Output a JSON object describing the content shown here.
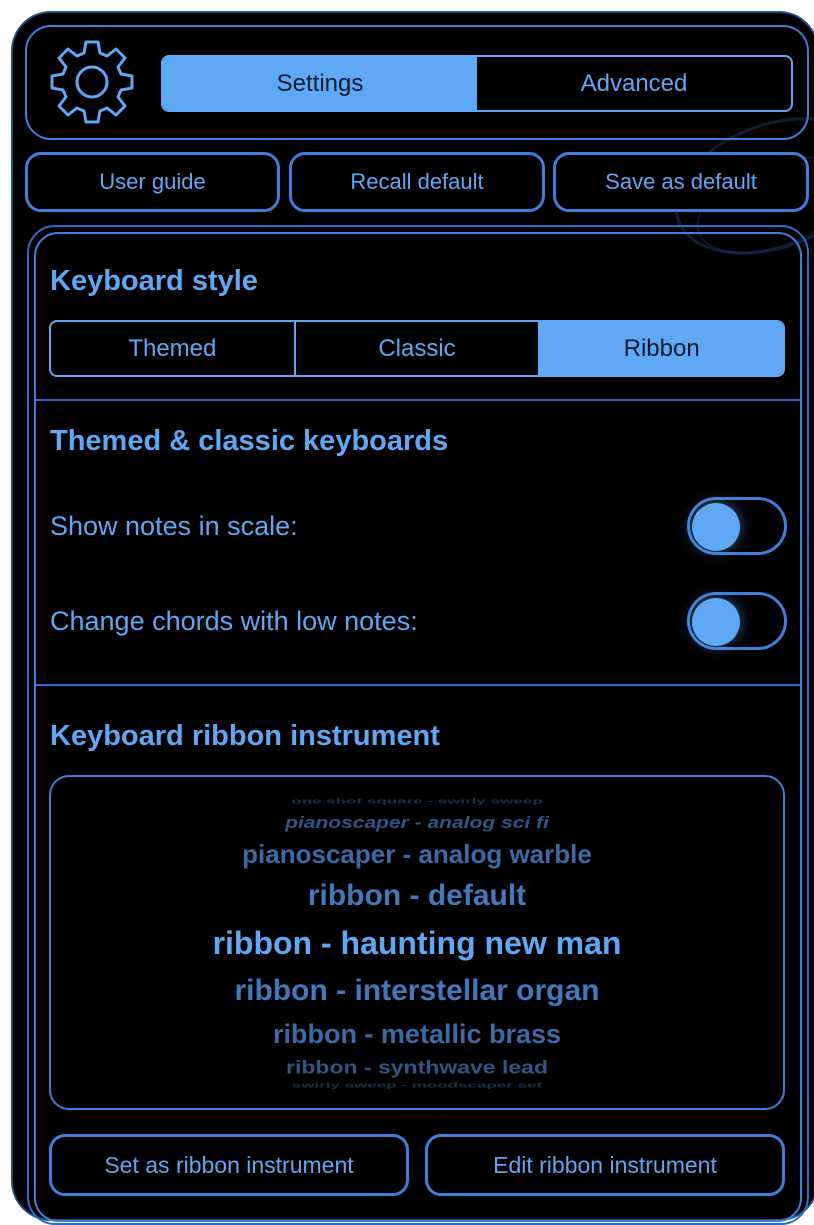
{
  "tabs": [
    {
      "label": "Settings",
      "active": true
    },
    {
      "label": "Advanced",
      "active": false
    }
  ],
  "actions": {
    "user_guide": "User guide",
    "recall_default": "Recall default",
    "save_default": "Save as default"
  },
  "keyboard_style": {
    "title": "Keyboard style",
    "options": [
      "Themed",
      "Classic",
      "Ribbon"
    ],
    "selected": "Ribbon"
  },
  "themed_classic": {
    "title": "Themed & classic keyboards",
    "show_notes_label": "Show notes in scale:",
    "show_notes_on": false,
    "change_chords_label": "Change chords with low notes:",
    "change_chords_on": false
  },
  "ribbon_instrument": {
    "title": "Keyboard ribbon instrument",
    "items": [
      "one shot square - swirly sweep",
      "pianoscaper - analog sci fi",
      "pianoscaper - analog warble",
      "ribbon - default",
      "ribbon - haunting new man",
      "ribbon - interstellar organ",
      "ribbon - metallic brass",
      "ribbon - synthwave lead",
      "swirly sweep - moodscaper set"
    ],
    "selected": "ribbon - haunting new man"
  },
  "bottom": {
    "set_ribbon": "Set as ribbon instrument",
    "edit_ribbon": "Edit ribbon instrument"
  },
  "colors": {
    "accent": "#5fa8f5",
    "border": "#3d7fd9",
    "background": "#000000"
  }
}
